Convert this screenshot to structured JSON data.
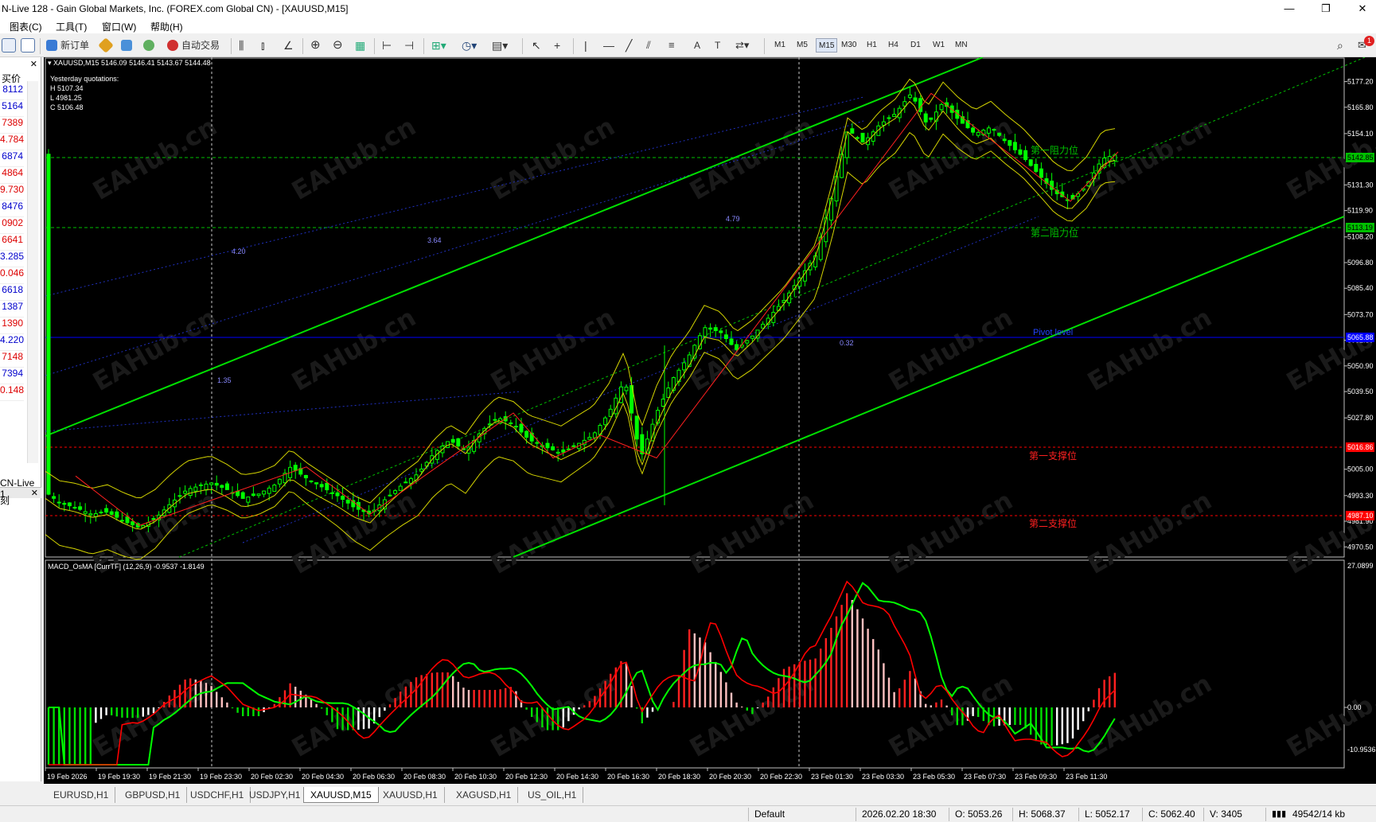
{
  "window": {
    "title": "N-Live 128 - Gain Global Markets, Inc. (FOREX.com Global CN) - [XAUUSD,M15]",
    "minimize": "—",
    "maximize": "❐",
    "close": "✕"
  },
  "menu": {
    "items": [
      "图表(C)",
      "工具(T)",
      "窗口(W)",
      "帮助(H)"
    ]
  },
  "toolbar": {
    "new_order": "新订单",
    "auto_trade": "自动交易",
    "timeframes": [
      "M1",
      "M5",
      "M15",
      "M30",
      "H1",
      "H4",
      "D1",
      "W1",
      "MN"
    ],
    "active_timeframe": "M15",
    "alert_badge": "1"
  },
  "market_watch": {
    "header": "买价",
    "prices": [
      {
        "v": "8112",
        "c": "blue"
      },
      {
        "v": "5164",
        "c": "blue"
      },
      {
        "v": "7389",
        "c": "red"
      },
      {
        "v": "4.784",
        "c": "red"
      },
      {
        "v": "6874",
        "c": "blue"
      },
      {
        "v": "4864",
        "c": "red"
      },
      {
        "v": "9.730",
        "c": "red"
      },
      {
        "v": "8476",
        "c": "blue"
      },
      {
        "v": "0902",
        "c": "red"
      },
      {
        "v": "6641",
        "c": "red"
      },
      {
        "v": "3.285",
        "c": "blue"
      },
      {
        "v": "0.046",
        "c": "red"
      },
      {
        "v": "6618",
        "c": "blue"
      },
      {
        "v": "1387",
        "c": "blue"
      },
      {
        "v": "1390",
        "c": "red"
      },
      {
        "v": "4.220",
        "c": "blue"
      },
      {
        "v": "7148",
        "c": "red"
      },
      {
        "v": "7394",
        "c": "blue"
      },
      {
        "v": "0.148",
        "c": "red"
      }
    ],
    "terminal_lines": [
      "CN-Live 1",
      "刻"
    ]
  },
  "chart": {
    "header": "XAUUSD,M15  5146.09 5146.41 5143.67 5144.48",
    "yesterday": {
      "title": "Yesterday quotations:",
      "h": "H 5107.34",
      "l": "L 4981.25",
      "c": "C 5106.48"
    },
    "labels": {
      "resistance1": "第一阻力位",
      "resistance2": "第二阻力位",
      "pivot": "Pivot level",
      "support1": "第一支撑位",
      "support2": "第二支撑位"
    },
    "zigzag_labels": [
      "4.20",
      "3.64",
      "4.79",
      "1.35",
      "0.32"
    ],
    "price_axis": [
      "5177.20",
      "5165.80",
      "5154.10",
      "5131.30",
      "5119.90",
      "5108.20",
      "5096.80",
      "5085.40",
      "5073.70",
      "5062.30",
      "5050.90",
      "5039.50",
      "5027.80",
      "5005.00",
      "4993.30",
      "4981.90",
      "4970.50"
    ],
    "price_tags": {
      "current": "5142.85",
      "resistance2": "5113.19",
      "pivot": "5065.88",
      "support1": "5016.86",
      "support2": "4987.10"
    },
    "macd_header": "MACD_OsMA [CurrTF] (12,26,9) -0.9537 -1.8149",
    "macd_axis": [
      "27.0899",
      "0.00",
      "-10.95366"
    ],
    "time_axis": [
      "19 Feb 2026",
      "19 Feb 19:30",
      "19 Feb 21:30",
      "19 Feb 23:30",
      "20 Feb 02:30",
      "20 Feb 04:30",
      "20 Feb 06:30",
      "20 Feb 08:30",
      "20 Feb 10:30",
      "20 Feb 12:30",
      "20 Feb 14:30",
      "20 Feb 16:30",
      "20 Feb 18:30",
      "20 Feb 20:30",
      "20 Feb 22:30",
      "23 Feb 01:30",
      "23 Feb 03:30",
      "23 Feb 05:30",
      "23 Feb 07:30",
      "23 Feb 09:30",
      "23 Feb 11:30"
    ],
    "watermark": "EAHub.cn",
    "colors": {
      "up": "#00ff00",
      "channel": "#00e000",
      "bollinger": "#d4d400",
      "zigzag": "#ff2020",
      "pivot": "#0000ff",
      "support": "#ff0000",
      "macd_signal": "#00ff00",
      "macd_main": "#ff0000"
    }
  },
  "tabs": [
    "EURUSD,H1",
    "GBPUSD,H1",
    "USDCHF,H1",
    "USDJPY,H1",
    "XAUUSD,M15",
    "XAUUSD,H1",
    "XAGUSD,H1",
    "US_OIL,H1"
  ],
  "active_tab": "XAUUSD,M15",
  "status": {
    "profile": "Default",
    "datetime": "2026.02.20 18:30",
    "open": "O: 5053.26",
    "high": "H: 5068.37",
    "low": "L: 5052.17",
    "close": "C: 5062.40",
    "volume": "V: 3405",
    "traffic": "49542/14 kb"
  }
}
